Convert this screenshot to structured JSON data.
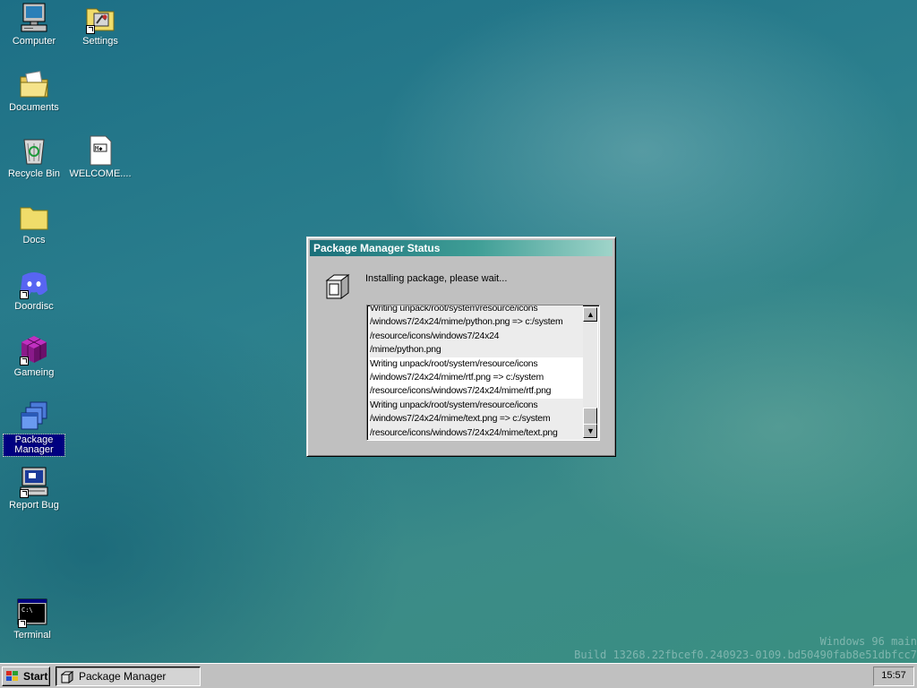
{
  "desktop": {
    "icons": [
      {
        "label": "Computer",
        "icon": "computer-icon"
      },
      {
        "label": "Settings",
        "icon": "settings-folder-icon"
      },
      {
        "label": "Documents",
        "icon": "documents-folder-icon"
      },
      {
        "label": "Recycle Bin",
        "icon": "recycle-bin-icon"
      },
      {
        "label": "WELCOME....",
        "icon": "document-file-icon"
      },
      {
        "label": "Docs",
        "icon": "folder-icon"
      },
      {
        "label": "Doordisc",
        "icon": "discord-icon"
      },
      {
        "label": "Gameing",
        "icon": "game-cube-icon"
      },
      {
        "label": "Package Manager",
        "icon": "package-manager-icon",
        "selected": true
      },
      {
        "label": "Report Bug",
        "icon": "report-bug-icon"
      },
      {
        "label": "Terminal",
        "icon": "terminal-icon"
      }
    ]
  },
  "dialog": {
    "title": "Package Manager Status",
    "message": "Installing package, please wait...",
    "log": [
      "Writing unpack/root/system/resource/icons",
      "/windows7/24x24/mime/python.png => c:/system",
      "/resource/icons/windows7/24x24",
      "/mime/python.png",
      "Writing unpack/root/system/resource/icons",
      "/windows7/24x24/mime/rtf.png => c:/system",
      "/resource/icons/windows7/24x24/mime/rtf.png",
      "Writing unpack/root/system/resource/icons",
      "/windows7/24x24/mime/text.png => c:/system",
      "/resource/icons/windows7/24x24/mime/text.png"
    ],
    "scroll_up": "▲",
    "scroll_down": "▼"
  },
  "watermark": {
    "line1": "Windows 96 main",
    "line2": "Build 13268.22fbcef0.240923-0109.bd50490fab8e51dbfcc7"
  },
  "taskbar": {
    "start_label": "Start",
    "tasks": [
      {
        "label": "Package Manager"
      }
    ],
    "clock": "15:57"
  },
  "colors": {
    "titlebar_start": "#1a6f7a",
    "titlebar_end": "#9fd4c9",
    "selection": "#000080",
    "face": "#c0c0c0"
  }
}
